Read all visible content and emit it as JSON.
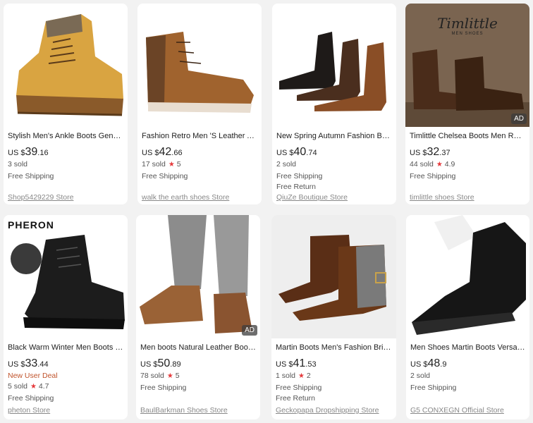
{
  "products": [
    {
      "title": "Stylish Men's Ankle Boots Genuine...",
      "currency": "US $",
      "price_main": "39",
      "price_cents": ".16",
      "sold": "3 sold",
      "rating": "",
      "deal": "",
      "shipping": "Free Shipping",
      "returns": "",
      "store": "Shop5429229 Store",
      "ad": ""
    },
    {
      "title": "Fashion Retro Men 'S Leather Ankl...",
      "currency": "US $",
      "price_main": "42",
      "price_cents": ".66",
      "sold": "17 sold",
      "rating": "5",
      "deal": "",
      "shipping": "Free Shipping",
      "returns": "",
      "store": "walk the earth shoes Store",
      "ad": ""
    },
    {
      "title": "New Spring Autumn Fashion Brow...",
      "currency": "US $",
      "price_main": "40",
      "price_cents": ".74",
      "sold": "2 sold",
      "rating": "",
      "deal": "",
      "shipping": "Free Shipping",
      "returns": "Free Return",
      "store": "QiuZe Boutique Store",
      "ad": ""
    },
    {
      "title": "Timlittle Chelsea Boots Men Retro ...",
      "currency": "US $",
      "price_main": "32",
      "price_cents": ".37",
      "sold": "44 sold",
      "rating": "4.9",
      "deal": "",
      "shipping": "Free Shipping",
      "returns": "",
      "store": "timlittle shoes Store",
      "ad": "AD",
      "brand_text": "Timlittle",
      "brand_sub": "MEN SHOES"
    },
    {
      "title": "Black Warm Winter Men Boots Ge...",
      "currency": "US $",
      "price_main": "33",
      "price_cents": ".44",
      "sold": "5 sold",
      "rating": "4.7",
      "deal": "New User Deal",
      "shipping": "Free Shipping",
      "returns": "",
      "store": "pheton Store",
      "ad": "",
      "brand_text": "PHERON"
    },
    {
      "title": "Men boots Natural Leather Boots f...",
      "currency": "US $",
      "price_main": "50",
      "price_cents": ".89",
      "sold": "78 sold",
      "rating": "5",
      "deal": "",
      "shipping": "Free Shipping",
      "returns": "",
      "store": "BaulBarkman Shoes Store",
      "ad": "AD"
    },
    {
      "title": "Martin Boots Men's Fashion Britis...",
      "currency": "US $",
      "price_main": "41",
      "price_cents": ".53",
      "sold": "1 sold",
      "rating": "2",
      "deal": "",
      "shipping": "Free Shipping",
      "returns": "Free Return",
      "store": "Geckopapa Dropshipping Store",
      "ad": ""
    },
    {
      "title": "Men Shoes Martin Boots Versatile ...",
      "currency": "US $",
      "price_main": "48",
      "price_cents": ".9",
      "sold": "2 sold",
      "rating": "",
      "deal": "",
      "shipping": "Free Shipping",
      "returns": "",
      "store": "G5 CONXEGN Official Store",
      "ad": ""
    }
  ],
  "icons": {
    "rating": "star-icon"
  },
  "colors": {
    "rating_star": "#e5393b",
    "deal": "#c0532b",
    "page_bg": "#f2f2f2"
  }
}
